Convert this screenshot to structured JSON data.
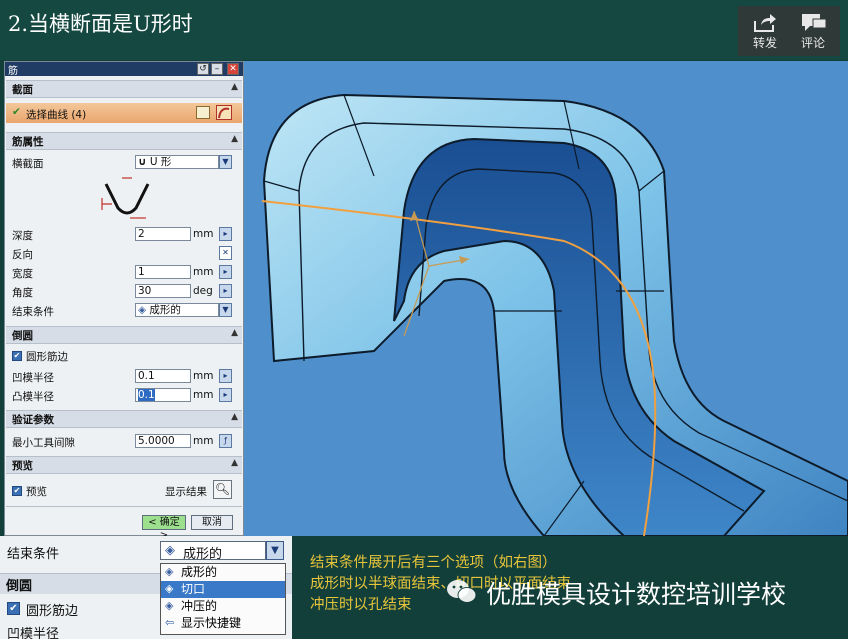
{
  "slide": {
    "title": "2.当横断面是U形时"
  },
  "share": {
    "forward_label": "转发",
    "comment_label": "评论"
  },
  "dialog": {
    "title": "筋",
    "section_crosssection": "截面",
    "select_curve_label": "选择曲线 (4)",
    "section_rib_props": "筋属性",
    "cross_section_label": "横截面",
    "cross_section_value": "U 形",
    "depth_label": "深度",
    "depth_value": "2",
    "depth_unit": "mm",
    "reverse_label": "反向",
    "width_label": "宽度",
    "width_value": "1",
    "width_unit": "mm",
    "angle_label": "角度",
    "angle_value": "30",
    "angle_unit": "deg",
    "end_condition_label": "结束条件",
    "end_condition_value": "成形的",
    "section_fillet": "倒圆",
    "round_rib_edge_label": "圆形筋边",
    "concave_radius_label": "凹模半径",
    "concave_radius_value": "0.1",
    "concave_radius_unit": "mm",
    "convex_radius_label": "凸模半径",
    "convex_radius_value": "0.1",
    "convex_radius_unit": "mm",
    "section_verify": "验证参数",
    "min_tool_clearance_label": "最小工具间隙",
    "min_tool_clearance_value": "5.0000",
    "min_tool_clearance_unit": "mm",
    "section_preview": "预览",
    "preview_label": "预览",
    "show_result_label": "显示结果",
    "ok_label": "< 确定 >",
    "cancel_label": "取消"
  },
  "bottom_panel": {
    "end_condition_label": "结束条件",
    "end_condition_value": "成形的",
    "fillet_section": "倒圆",
    "round_rib_edge_label": "圆形筋边",
    "partial_label": "凹模半径",
    "dropdown_options": [
      "成形的",
      "切口",
      "冲压的",
      "显示快捷键"
    ],
    "selected_option": "切口"
  },
  "note": {
    "line1": "结束条件展开后有三个选项（如右图）",
    "line2": "成形时以半球面结束、切口时以平面结束",
    "line3": "冲压时以孔结束"
  },
  "watermark": {
    "text": "优胜模具设计数控培训学校"
  },
  "colors": {
    "slide_bg": "#123f39",
    "viewport_bg": "#4f90cc",
    "note_text": "#e7c43a",
    "selection": "#3a78c8"
  }
}
